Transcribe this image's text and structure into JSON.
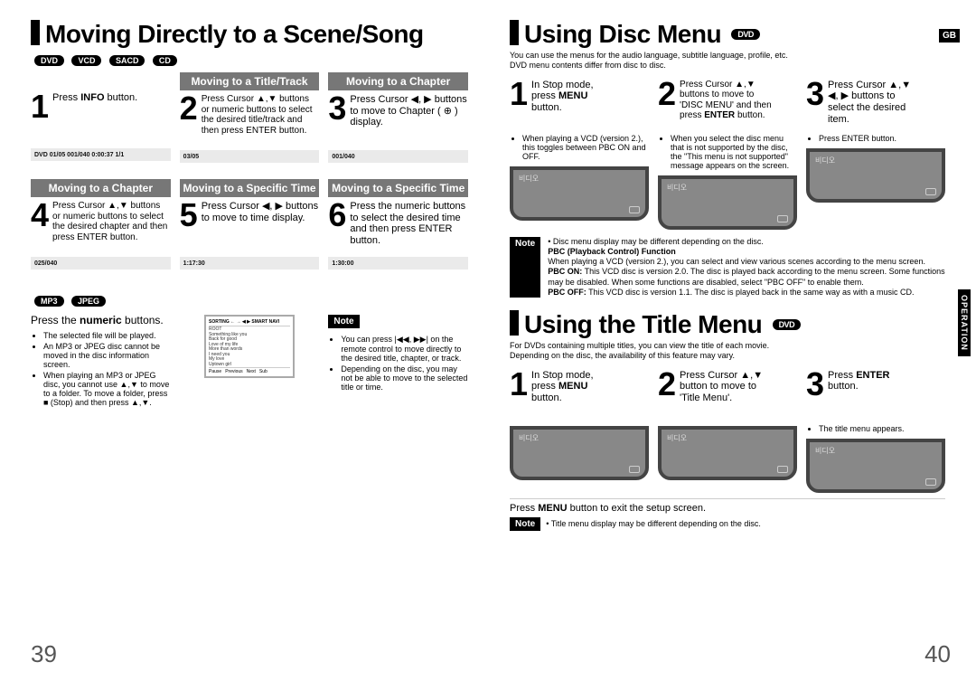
{
  "left": {
    "title": "Moving Directly to a Scene/Song",
    "badges": [
      "DVD",
      "VCD",
      "SACD",
      "CD"
    ],
    "sec1": {
      "num": "1",
      "text_prefix": "Press ",
      "text_bold": "INFO",
      "text_suffix": " button.",
      "strip": "DVD  01/05  001/040  0:00:37  1/1"
    },
    "sec2": {
      "heading": "Moving to a Title/Track",
      "num": "2",
      "text": "Press Cursor ▲,▼ buttons or numeric buttons to select the desired title/track and then press ENTER button.",
      "strip": "03/05"
    },
    "sec3": {
      "heading": "Moving to a Chapter",
      "num": "3",
      "text": "Press Cursor ◀, ▶ buttons to move to Chapter ( ⊕ ) display.",
      "strip": "001/040"
    },
    "sec4": {
      "heading": "Moving to a Chapter",
      "num": "4",
      "text": "Press Cursor ▲,▼ buttons or numeric buttons to select the desired chapter and then press ENTER button.",
      "strip": "025/040"
    },
    "sec5": {
      "heading": "Moving to a Specific Time",
      "num": "5",
      "text": "Press Cursor ◀, ▶ buttons to move to time display.",
      "strip": "1:17:30"
    },
    "sec6": {
      "heading": "Moving to a Specific Time",
      "num": "6",
      "text": "Press the numeric buttons to select the desired time and then press ENTER button.",
      "strip": "1:30:00"
    },
    "mp3_badges": [
      "MP3",
      "JPEG"
    ],
    "mp3_text_prefix": "Press the ",
    "mp3_text_bold": "numeric",
    "mp3_text_suffix": " buttons.",
    "mp3_bullets": [
      "The selected file will be played.",
      "An MP3 or JPEG disc cannot be moved in the disc information screen.",
      "When playing an MP3 or JPEG disc, you cannot use ▲,▼ to move to a folder. To move a folder, press ■ (Stop) and then press ▲,▼."
    ],
    "mini_header": "SORTING ← → ◀ ▶ SMART NAVI",
    "mini_rows": [
      "ROOT",
      "Something like you",
      "Back for good",
      "Love of my life",
      "More than words",
      "I need you",
      "My love",
      "Uptown girl"
    ],
    "mini_footer": [
      "Pause",
      "Previous",
      "Next",
      "Sub"
    ],
    "note_label": "Note",
    "note_bullets": [
      "You can press |◀◀, ▶▶| on the remote control to move directly to the desired title, chapter, or track.",
      "Depending on the disc, you may not be able to move to the selected title or time."
    ],
    "page_num": "39"
  },
  "right": {
    "gb": "GB",
    "operation": "OPERATION",
    "disc": {
      "title": "Using Disc Menu",
      "badge": "DVD",
      "sub": "You can use the menus for the audio language, subtitle language, profile, etc.\nDVD menu contents differ from disc to disc.",
      "step1": {
        "num": "1",
        "line1": "In Stop mode,",
        "line2_pre": "press ",
        "line2_bold": "MENU",
        "line3": "button.",
        "note": "When playing a VCD (version 2.), this toggles between PBC ON and OFF."
      },
      "step2": {
        "num": "2",
        "line1": "Press Cursor ▲,▼",
        "line2": "buttons to move to",
        "line3": "'DISC MENU' and then",
        "line4_pre": "press ",
        "line4_bold": "ENTER",
        "line4_suf": " button.",
        "note": "When you select the disc menu that is not supported by the disc, the \"This menu is not supported\" message appears on the screen."
      },
      "step3": {
        "num": "3",
        "line1": "Press Cursor ▲,▼",
        "line2": "◀, ▶ buttons to",
        "line3": "select the desired",
        "line4": "item.",
        "note": "Press ENTER button."
      },
      "note_label": "Note",
      "note_line1": "Disc menu display may be different depending on the disc.",
      "note_line2_bold": "PBC (Playback Control) Function",
      "note_line3": "When playing a VCD (version 2.), you can select and view various scenes according to the menu screen.",
      "pbc_on_label": "PBC ON:",
      "pbc_on_text": "This VCD disc is version 2.0. The disc is played back according to the menu screen. Some functions may be disabled. When some functions are disabled, select \"PBC OFF\" to enable them.",
      "pbc_off_label": "PBC OFF:",
      "pbc_off_text": "This VCD disc is version 1.1. The disc is played back in the same way as with a music CD."
    },
    "title_menu": {
      "title": "Using the Title Menu",
      "badge": "DVD",
      "sub": "For DVDs containing multiple titles, you can view the title of each movie.\nDepending on the disc, the availability of this feature may vary.",
      "step1": {
        "num": "1",
        "line1": "In Stop mode,",
        "line2_pre": "press ",
        "line2_bold": "MENU",
        "line3": "button."
      },
      "step2": {
        "num": "2",
        "line1": "Press Cursor ▲,▼",
        "line2": "button to move to",
        "line3": "'Title Menu'."
      },
      "step3": {
        "num": "3",
        "line1_pre": "Press ",
        "line1_bold": "ENTER",
        "line2": "button.",
        "note": "The title menu appears."
      },
      "exit_pre": "Press ",
      "exit_bold": "MENU",
      "exit_suf": " button to exit the setup screen.",
      "note_label": "Note",
      "bottom_note": "Title menu display may be different depending on the disc."
    },
    "page_num": "40"
  },
  "crt_label": "비디오"
}
